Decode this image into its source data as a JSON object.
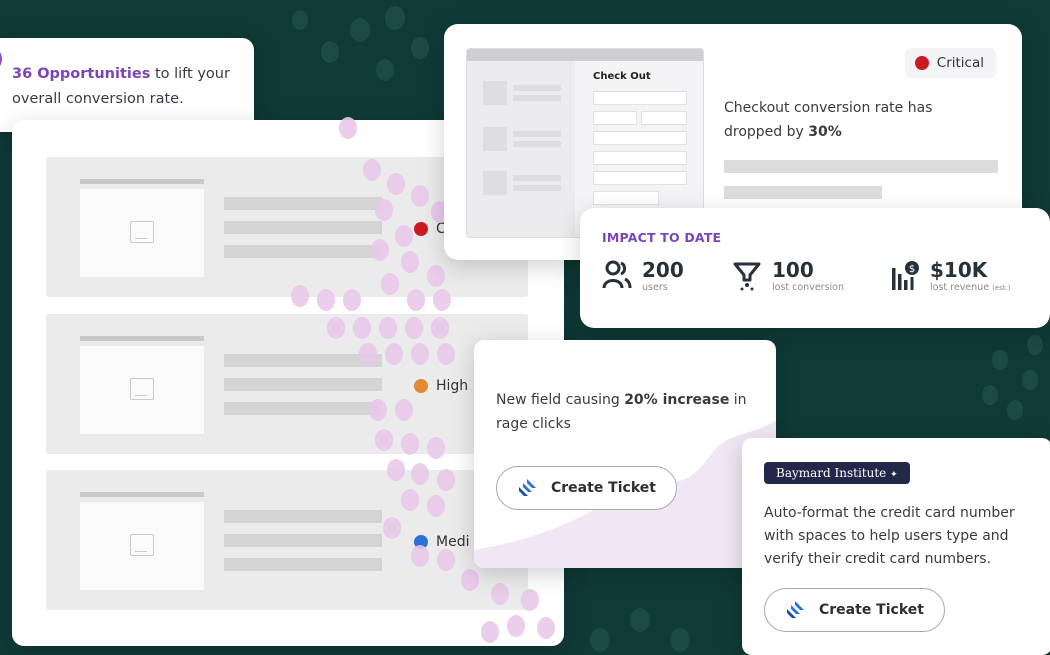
{
  "colors": {
    "background": "#0f3a36",
    "accent": "#7b45b8",
    "critical": "#cc1a22",
    "high": "#e38a30",
    "medium": "#2c6fd6",
    "jira": "#2f6fd8"
  },
  "opportunities": {
    "count_text": "36 Opportunities",
    "rest_line1": " to lift your",
    "line2": "overall conversion rate."
  },
  "list": {
    "rows": [
      {
        "priority": "Critical",
        "priority_visible": "C",
        "color": "#cc1a22"
      },
      {
        "priority": "High",
        "priority_visible": "High",
        "color": "#e38a30"
      },
      {
        "priority": "Medium",
        "priority_visible": "Medi",
        "color": "#2c6fd6"
      }
    ]
  },
  "checkout": {
    "mock_title": "Check Out",
    "badge": "Critical",
    "text_line1": "Checkout conversion rate has",
    "text_line2_prefix": "dropped by ",
    "text_line2_bold": "30%"
  },
  "impact": {
    "title": "IMPACT TO DATE",
    "stats": [
      {
        "icon": "users-icon",
        "value": "200",
        "label": "users",
        "label_suffix": ""
      },
      {
        "icon": "funnel-icon",
        "value": "100",
        "label": "lost conversion",
        "label_suffix": ""
      },
      {
        "icon": "revenue-chart-icon",
        "value": "$10K",
        "label": "lost revenue ",
        "label_suffix": "(est.)"
      }
    ]
  },
  "new_field": {
    "line1_prefix": "New field causing ",
    "line1_bold": "20% increase",
    "line1_suffix": " in",
    "line2": "rage clicks",
    "button": "Create Ticket"
  },
  "baymard": {
    "logo": "Baymard Institute",
    "text": "Auto-format the credit card number with spaces to help users type and verify their credit card numbers.",
    "button": "Create Ticket"
  }
}
